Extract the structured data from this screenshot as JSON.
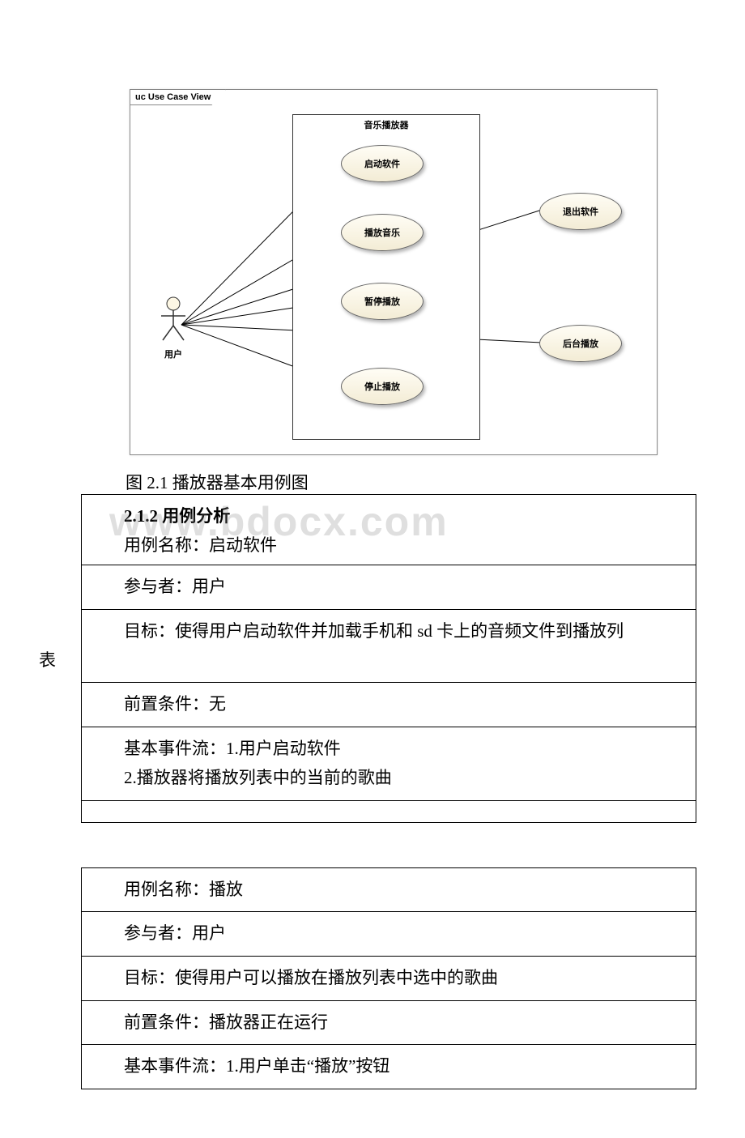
{
  "diagram": {
    "tab": "uc Use Case View",
    "system_name": "音乐播放器",
    "actor_label": "用户",
    "usecases": {
      "start": "启动软件",
      "play": "播放音乐",
      "pause": "暂停播放",
      "stop": "停止播放",
      "exit": "退出软件",
      "background": "后台播放"
    }
  },
  "caption": "图 2.1 播放器基本用例图",
  "section_heading": "2.1.2 用例分析",
  "watermark": "www.bdocx.com",
  "usecase1": {
    "name_row": "用例名称：启动软件",
    "actor_row": "参与者：用户",
    "target_row": "目标：使得用户启动软件并加载手机和 sd 卡上的音频文件到播放列",
    "target_row_cont": "表",
    "precond_row": "前置条件：无",
    "flow_row_1": "基本事件流：1.用户启动软件",
    "flow_row_2": "2.播放器将播放列表中的当前的歌曲"
  },
  "usecase2": {
    "name_row": "用例名称：播放",
    "actor_row": "参与者：用户",
    "target_row": "目标：使得用户可以播放在播放列表中选中的歌曲",
    "precond_row": "前置条件：播放器正在运行",
    "flow_row": "基本事件流：1.用户单击“播放”按钮"
  }
}
